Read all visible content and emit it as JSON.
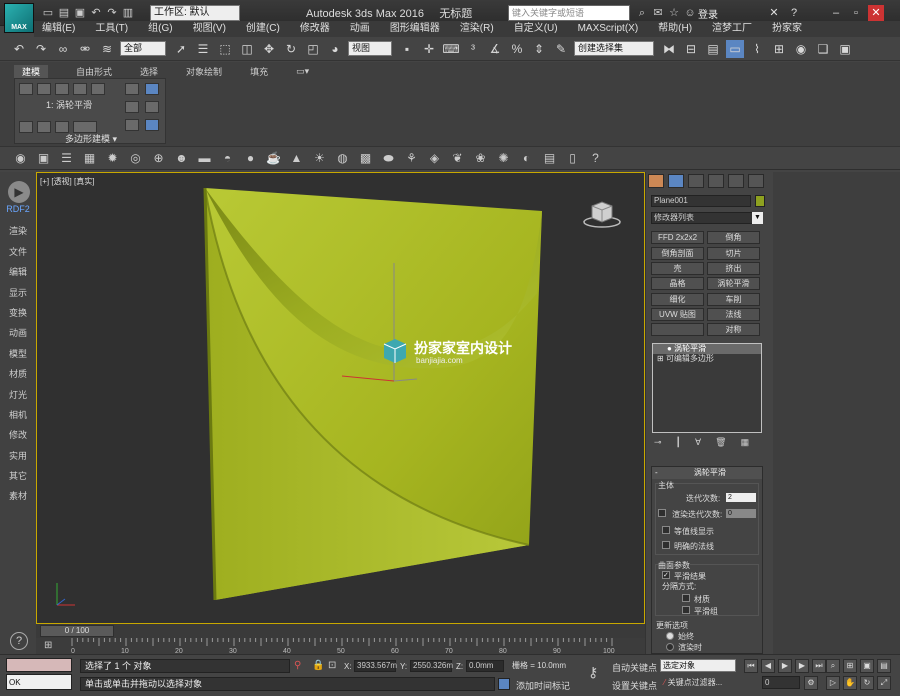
{
  "app": {
    "title": "Autodesk 3ds Max 2016",
    "doc": "无标题",
    "logo": "MAX",
    "workspace": "工作区: 默认",
    "search_placeholder": "键入关键字或短语",
    "login": "登录"
  },
  "menu": [
    "编辑(E)",
    "工具(T)",
    "组(G)",
    "视图(V)",
    "创建(C)",
    "修改器",
    "动画",
    "图形编辑器",
    "渲染(R)",
    "自定义(U)",
    "MAXScript(X)",
    "帮助(H)",
    "渲梦工厂",
    "扮家家"
  ],
  "toolbar": {
    "selection_filter": "全部",
    "ref_coord": "视图",
    "named_set": "创建选择集"
  },
  "ribbon": {
    "tabs": [
      "建模",
      "自由形式",
      "选择",
      "对象绘制",
      "填充"
    ],
    "active_tab": "建模",
    "poly_mode": "1: 涡轮平滑",
    "panel_label": "多边形建模"
  },
  "leftnav": [
    "RDF2",
    "渲染",
    "文件",
    "编辑",
    "显示",
    "变换",
    "动画",
    "模型",
    "材质",
    "灯光",
    "相机",
    "修改",
    "实用",
    "其它",
    "素材"
  ],
  "viewport": {
    "label": "[+] [透视] [真实]",
    "watermark_title": "扮家家室内设计",
    "watermark_url": "banjiajia.com",
    "object_color": "#a6b520"
  },
  "command_panel": {
    "object_name": "Plane001",
    "modifier_list": "修改器列表",
    "modifier_buttons": [
      "FFD 2x2x2",
      "倒角",
      "倒角剖面",
      "切片",
      "壳",
      "挤出",
      "晶格",
      "涡轮平滑",
      "细化",
      "车削",
      "UVW 贴图",
      "法线",
      "",
      "对称"
    ],
    "stack": [
      "涡轮平滑",
      "可编辑多边形"
    ],
    "rollout": {
      "title": "涡轮平滑",
      "main_group": "主体",
      "iterations_label": "迭代次数:",
      "iterations": "2",
      "render_iters_label": "渲染迭代次数:",
      "render_iters": "0",
      "isoline": "等值线显示",
      "explicit_normals": "明确的法线",
      "surface_group": "曲面参数",
      "smooth_result": "平滑结果",
      "separate_by": "分隔方式:",
      "materials": "材质",
      "smoothing_groups": "平滑组",
      "update_group": "更新选项",
      "always": "始终",
      "when_render": "渲染时"
    }
  },
  "timeline": {
    "slider": "0 / 100",
    "ticks": [
      "0",
      "10",
      "20",
      "30",
      "40",
      "50",
      "60",
      "70",
      "80",
      "90",
      "100"
    ]
  },
  "status": {
    "maxscript": "OK",
    "message1": "选择了 1 个 对象",
    "message2": "单击或单击并拖动以选择对象",
    "x_label": "X:",
    "x": "3933.567m",
    "y_label": "Y:",
    "y": "2550.326m",
    "z_label": "Z:",
    "z": "0.0mm",
    "grid": "栅格 = 10.0mm",
    "add_time_tag": "添加时间标记",
    "auto_key": "自动关键点",
    "set_key": "设置关键点",
    "key_select": "选定对象",
    "key_filter": "关键点过滤器...",
    "frame": "0"
  }
}
